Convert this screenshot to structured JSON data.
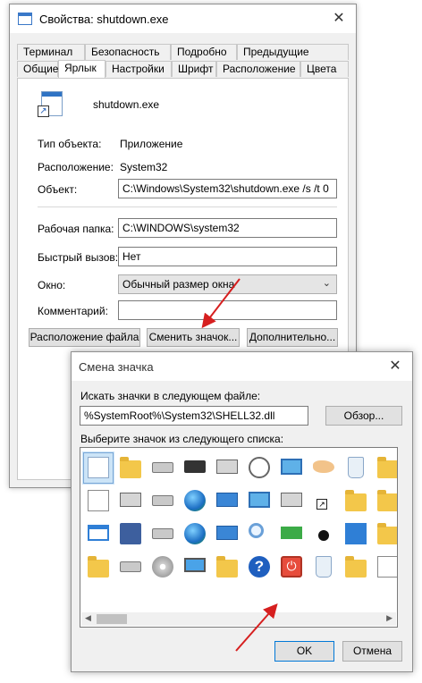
{
  "properties_window": {
    "title": "Свойства: shutdown.exe",
    "close_glyph": "✕",
    "tabs_back": [
      "Терминал",
      "Безопасность",
      "Подробно",
      "Предыдущие версии"
    ],
    "tabs_front": [
      "Общие",
      "Ярлык",
      "Настройки",
      "Шрифт",
      "Расположение",
      "Цвета"
    ],
    "active_tab": "Ярлык",
    "file_name": "shutdown.exe",
    "rows": {
      "type_label": "Тип объекта:",
      "type_value": "Приложение",
      "location_label": "Расположение:",
      "location_value": "System32",
      "target_label": "Объект:",
      "target_value": "C:\\Windows\\System32\\shutdown.exe /s /t 0",
      "workdir_label": "Рабочая папка:",
      "workdir_value": "C:\\WINDOWS\\system32",
      "hotkey_label": "Быстрый вызов:",
      "hotkey_value": "Нет",
      "window_label": "Окно:",
      "window_value": "Обычный размер окна",
      "comment_label": "Комментарий:",
      "comment_value": ""
    },
    "buttons": {
      "open_location": "Расположение файла",
      "change_icon": "Сменить значок...",
      "advanced": "Дополнительно..."
    }
  },
  "change_icon_dialog": {
    "title": "Смена значка",
    "close_glyph": "✕",
    "file_label": "Искать значки в следующем файле:",
    "file_value": "%SystemRoot%\\System32\\SHELL32.dll",
    "browse_button": "Обзор...",
    "list_label": "Выберите значок из следующего списка:",
    "ok_button": "OK",
    "cancel_button": "Отмена",
    "help_glyph": "?",
    "power_glyph": "⏻",
    "scroll_left": "◀",
    "scroll_right": "▶"
  },
  "icons": [
    [
      "document-icon",
      "folder-icon",
      "drive-icon",
      "chip-icon",
      "printer-icon",
      "clock-document-icon",
      "screen-icon",
      "share-hand-icon",
      "recycle-bin-icon",
      "folder-icon"
    ],
    [
      "text-document-icon",
      "computer-network-icon",
      "network-drive-icon",
      "globe-icon",
      "network-computers-icon",
      "control-panel-icon",
      "program-window-icon",
      "shortcut-overlay-icon",
      "folder-files-icon",
      "folder-drive-icon"
    ],
    [
      "window-icon",
      "save-floppy-icon",
      "network-drive-disconnected-icon",
      "globe-search-icon",
      "network-icon",
      "search-icon",
      "green-drive-icon",
      "lock-overlay-icon",
      "blue-screen-icon",
      "folder-text-icon"
    ],
    [
      "folder-icon",
      "drive-icon",
      "disc-drive-icon",
      "monitor-icon",
      "folder-grid-icon",
      "help-icon",
      "power-icon",
      "recycle-bin-empty-icon",
      "folder-tools-icon",
      "checklist-icon"
    ]
  ],
  "selected_icon": "power-icon",
  "colors": {
    "accent_red": "#d61f1f",
    "selection": "#cce4f7"
  }
}
